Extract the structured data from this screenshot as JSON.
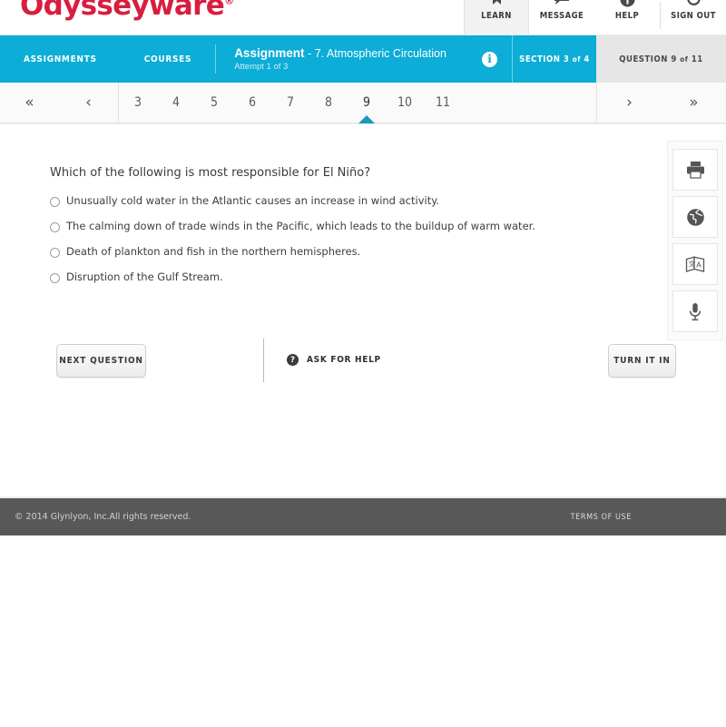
{
  "brand": {
    "logo_text": "Odysseyware",
    "registered_mark": "®",
    "logo_color": "#d81e3f",
    "accent_color": "#0cadd6"
  },
  "global_nav": {
    "items": [
      {
        "label": "LEARN",
        "icon": "bookmark-icon",
        "active": true
      },
      {
        "label": "MESSAGE",
        "icon": "speech-bubble-icon",
        "active": false
      },
      {
        "label": "HELP",
        "icon": "info-circle-icon",
        "active": false
      },
      {
        "label": "SIGN OUT",
        "icon": "power-icon",
        "active": false
      }
    ]
  },
  "assignment_bar": {
    "assignments_label": "ASSIGNMENTS",
    "courses_label": "COURSES",
    "title_strong": "Assignment",
    "title_rest": "- 7. Atmospheric Circulation",
    "attempt": "Attempt 1 of 3",
    "info_glyph": "i",
    "section_prefix": "SECTION",
    "section_current": "3",
    "section_of": "of",
    "section_total": "4",
    "question_prefix": "QUESTION",
    "question_current": "9",
    "question_of": "of",
    "question_total": "11"
  },
  "pagination": {
    "first_glyph": "«",
    "prev_glyph": "‹",
    "next_glyph": "›",
    "last_glyph": "»",
    "pages": [
      "3",
      "4",
      "5",
      "6",
      "7",
      "8",
      "9",
      "10",
      "11"
    ],
    "active_page": "9"
  },
  "question": {
    "prompt": "Which of the following is most responsible for El Niño?",
    "choices": [
      {
        "text": "Unusually cold water in the Atlantic causes an increase in wind activity.",
        "selected": false
      },
      {
        "text": "The calming down of trade winds in the Pacific, which leads to the buildup of warm water.",
        "selected": false
      },
      {
        "text": "Death of plankton and fish in the northern hemispheres.",
        "selected": false
      },
      {
        "text": "Disruption of the Gulf Stream.",
        "selected": false
      }
    ]
  },
  "tools": [
    {
      "name": "print-icon",
      "title": "Print"
    },
    {
      "name": "globe-icon",
      "title": "Web"
    },
    {
      "name": "translate-icon",
      "title": "Translate"
    },
    {
      "name": "microphone-icon",
      "title": "Read aloud"
    }
  ],
  "actions": {
    "next_question": "NEXT QUESTION",
    "ask_for_help": "ASK FOR HELP",
    "ask_for_help_glyph": "?",
    "turn_it_in": "TURN IT IN"
  },
  "footer": {
    "copyright": "© 2014 Glynlyon, Inc.All rights reserved.",
    "terms": "TERMS OF USE"
  }
}
